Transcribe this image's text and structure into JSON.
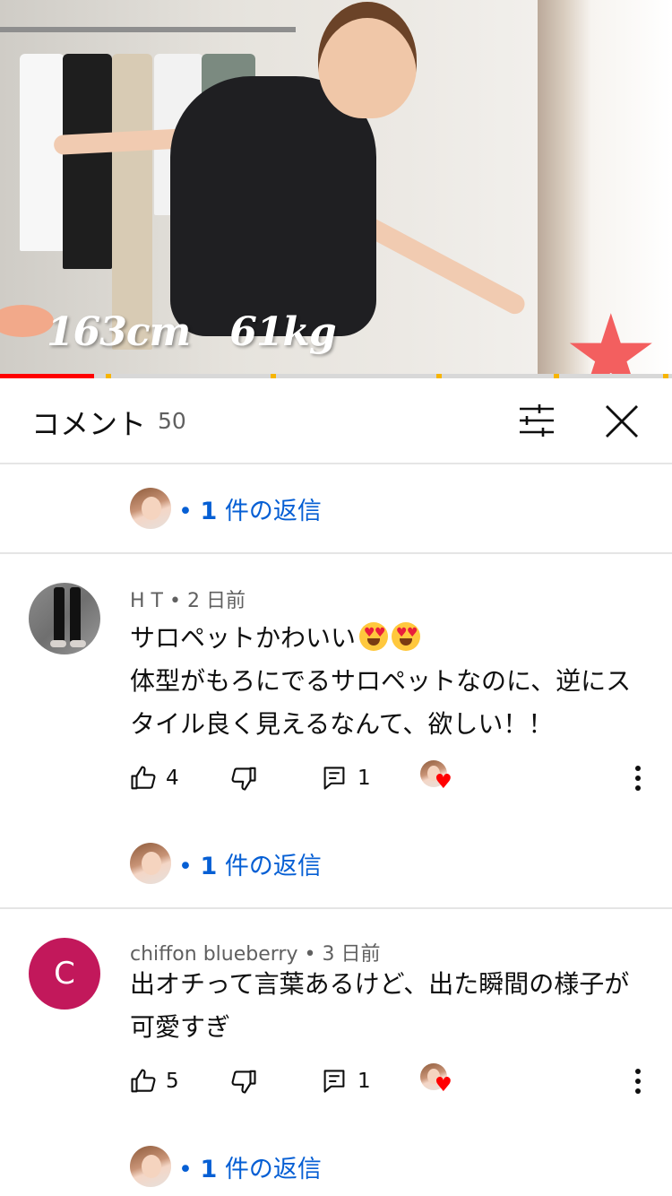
{
  "video": {
    "caption_height": "163cm",
    "caption_weight": "61kg",
    "progress_played": 0.14
  },
  "header": {
    "title": "コメント",
    "count": "50"
  },
  "replies_prefix": "•",
  "replies_count": "1",
  "replies_suffix": "件の返信",
  "comments": [
    {
      "author": "H T",
      "time": "2 日前",
      "text_line1": "サロペットかわいい",
      "text_rest": "体型がもろにでるサロペットなのに、逆にスタイル良く見えるなんて、欲しい！！",
      "likes": "4",
      "replies": "1"
    },
    {
      "author": "chiffon blueberry",
      "avatar_letter": "C",
      "avatar_color": "#c2185b",
      "time": "3 日前",
      "text": "出オチって言葉あるけど、出た瞬間の様子が可愛すぎ",
      "likes": "5",
      "replies": "1"
    }
  ],
  "separator": "•",
  "colors": {
    "link_blue": "#065fd4",
    "progress_red": "#ff0000",
    "heart_red": "#ff0000"
  }
}
